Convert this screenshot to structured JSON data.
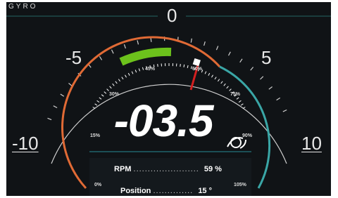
{
  "brand": "GYRO",
  "scale_labels": {
    "zero": "0",
    "neg5": "-5",
    "pos5": "5",
    "neg10": "-10",
    "pos10": "10"
  },
  "percent_labels": {
    "p0": "0%",
    "p15": "15%",
    "p30": "30%",
    "p45": "45%",
    "p60": "60%",
    "p75": "75%",
    "p90": "90%",
    "p105": "105%"
  },
  "main_value": "-03.5",
  "rpm": {
    "label": "RPM",
    "dots": ".......................",
    "value": "59 %"
  },
  "position": {
    "label": "Position",
    "dots": "..............",
    "value": "15 °"
  },
  "colors": {
    "accent_orange": "#e06a35",
    "accent_teal": "#3aa6a6",
    "indicator_green": "#6cc21c",
    "needle_red": "#d42020"
  },
  "icons": {
    "gyro_icon": "gyro-symbol"
  }
}
